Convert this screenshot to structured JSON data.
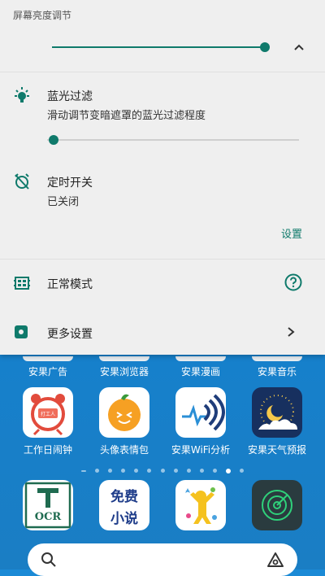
{
  "panel": {
    "title": "屏幕亮度调节",
    "brightness": {
      "level": 0.99,
      "icon": "moon-icon"
    },
    "blue_filter": {
      "title": "蓝光过滤",
      "subtitle": "滑动调节变暗遮罩的蓝光过滤程度",
      "level": 0.0,
      "icon": "bulb-icon"
    },
    "timer": {
      "title": "定时开关",
      "status": "已关闭",
      "settings_label": "设置",
      "icon": "alarm-off-icon"
    },
    "mode": {
      "title": "正常模式",
      "icon": "mode-icon",
      "help_icon": "help-icon"
    },
    "more": {
      "title": "更多设置",
      "icon": "gear-icon",
      "arrow_icon": "chevron-right-icon"
    },
    "accent_color": "#0f7a6b"
  },
  "launcher": {
    "top_row_labels": [
      "安果广告",
      "安果浏览器",
      "安果漫画",
      "安果音乐"
    ],
    "row2_labels": [
      "工作日闹钟",
      "头像表情包",
      "安果WiFi分析",
      "安果天气预报"
    ],
    "page_dots": {
      "count": 13,
      "active_index": 11
    },
    "dock_icons": [
      {
        "name": "ocr-icon",
        "text": "OCR"
      },
      {
        "name": "novel-icon",
        "text_top": "免费",
        "text_bottom": "小说"
      },
      {
        "name": "kids-icon"
      },
      {
        "name": "radar-icon"
      }
    ],
    "clock_app_text": "打工人",
    "search": {
      "icon": "search-icon",
      "assistant_icon": "assistant-icon"
    }
  }
}
